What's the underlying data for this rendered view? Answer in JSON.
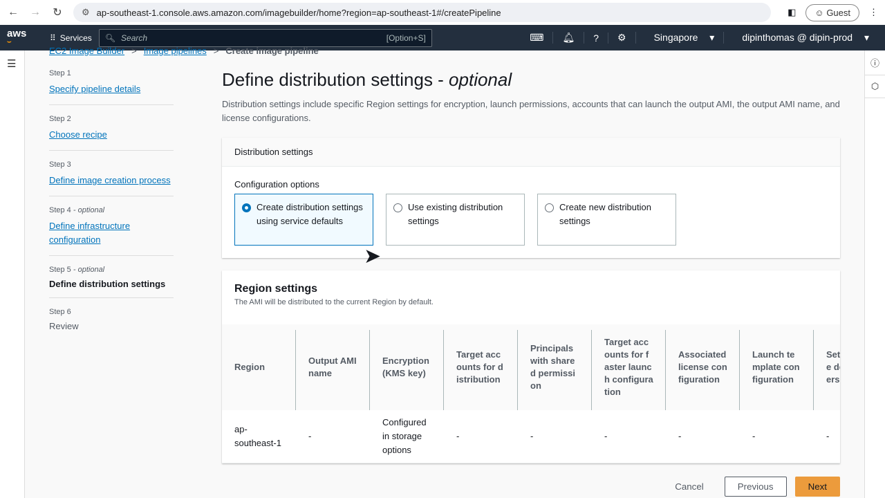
{
  "browser": {
    "url": "ap-southeast-1.console.aws.amazon.com/imagebuilder/home?region=ap-southeast-1#/createPipeline",
    "profile": "Guest"
  },
  "topnav": {
    "logo": "aws",
    "services": "Services",
    "search_placeholder": "Search",
    "search_shortcut": "[Option+S]",
    "region": "Singapore",
    "account": "dipinthomas @ dipin-prod"
  },
  "breadcrumb": [
    "EC2 Image Builder",
    "Image pipelines",
    "Create image pipeline"
  ],
  "steps": [
    {
      "n": "Step 1",
      "label": "Specify pipeline details"
    },
    {
      "n": "Step 2",
      "label": "Choose recipe"
    },
    {
      "n": "Step 3",
      "label": "Define image creation process"
    },
    {
      "n": "Step 4",
      "opt": "- optional",
      "label": "Define infrastructure configuration"
    },
    {
      "n": "Step 5",
      "opt": "- optional",
      "label": "Define distribution settings"
    },
    {
      "n": "Step 6",
      "label": "Review"
    }
  ],
  "page": {
    "title": "Define distribution settings - ",
    "title_em": "optional",
    "description": "Distribution settings include specific Region settings for encryption, launch permissions, accounts that can launch the output AMI, the output AMI name, and license configurations."
  },
  "distribution": {
    "header": "Distribution settings",
    "config_label": "Configuration options",
    "options": [
      "Create distribution settings using service defaults",
      "Use existing distribution settings",
      "Create new distribution settings"
    ],
    "selected": 0
  },
  "region_settings": {
    "title": "Region settings",
    "subtitle": "The AMI will be distributed to the current Region by default.",
    "columns": [
      "Region",
      "Output AMI name",
      "Encryption (KMS key)",
      "Target accounts for distribution",
      "Principals with shared permission",
      "Target accounts for faster launch configuration",
      "Associated license configuration",
      "Launch template configuration",
      "Set template default version"
    ],
    "rows": [
      [
        "ap-southeast-1",
        "-",
        "Configured in storage options",
        "-",
        "-",
        "-",
        "-",
        "-",
        "-"
      ]
    ]
  },
  "actions": {
    "cancel": "Cancel",
    "previous": "Previous",
    "next": "Next"
  }
}
